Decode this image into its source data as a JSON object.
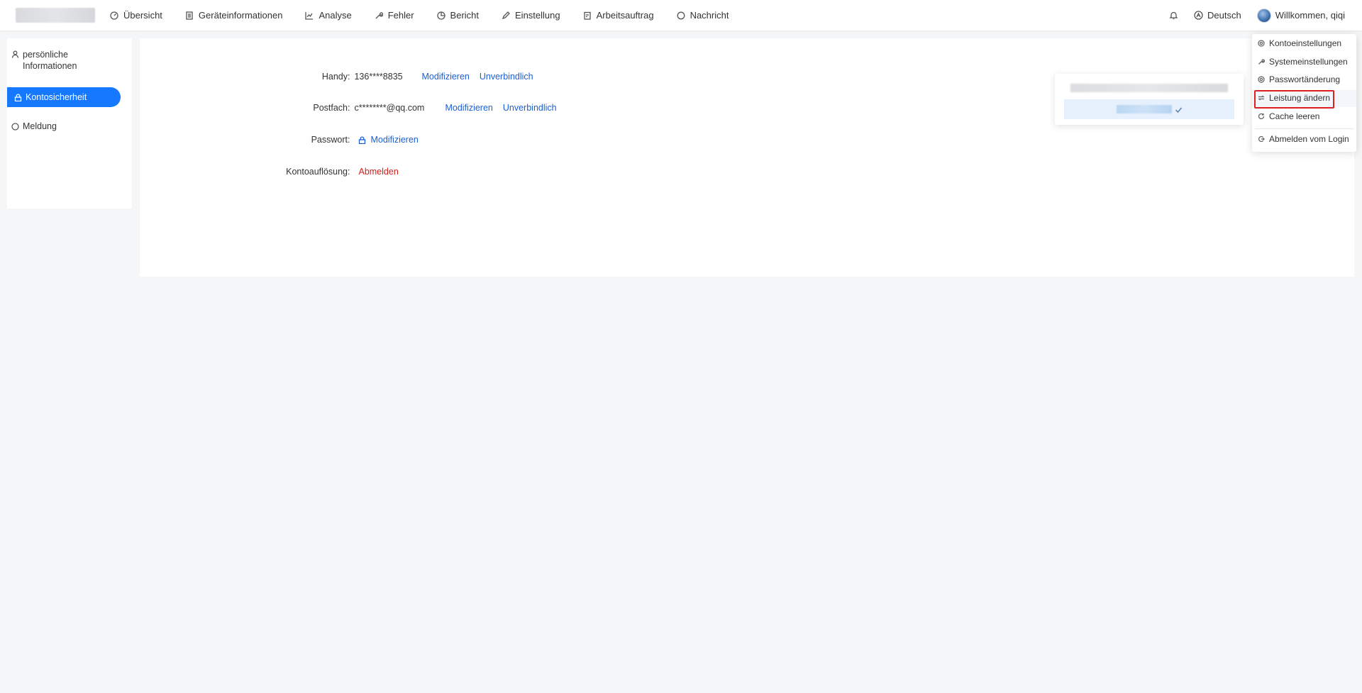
{
  "nav": {
    "items": [
      {
        "label": "Übersicht",
        "icon": "dashboard-icon"
      },
      {
        "label": "Geräteinformationen",
        "icon": "list-icon"
      },
      {
        "label": "Analyse",
        "icon": "chart-line-icon"
      },
      {
        "label": "Fehler",
        "icon": "wrench-icon"
      },
      {
        "label": "Bericht",
        "icon": "pie-chart-icon"
      },
      {
        "label": "Einstellung",
        "icon": "pencil-icon"
      },
      {
        "label": "Arbeitsauftrag",
        "icon": "clipboard-icon"
      },
      {
        "label": "Nachricht",
        "icon": "chat-icon"
      }
    ],
    "language": "Deutsch",
    "welcome": "Willkommen, qiqi"
  },
  "sidebar": {
    "items": [
      {
        "label": "persönliche Informationen",
        "icon": "user-icon"
      },
      {
        "label": "Kontosicherheit",
        "icon": "lock-icon",
        "active": true
      },
      {
        "label": "Meldung",
        "icon": "chat-icon"
      }
    ]
  },
  "security": {
    "phone": {
      "label": "Handy",
      "value": "136****8835",
      "modify": "Modifizieren",
      "unbind": "Unverbindlich"
    },
    "mail": {
      "label": "Postfach",
      "value": "c********@qq.com",
      "modify": "Modifizieren",
      "unbind": "Unverbindlich"
    },
    "password": {
      "label": "Passwort",
      "modify": "Modifizieren"
    },
    "cancellation": {
      "label": "Kontoauflösung",
      "action": "Abmelden"
    }
  },
  "dropdown": {
    "items": [
      {
        "label": "Kontoeinstellungen",
        "icon": "gear-icon"
      },
      {
        "label": "Systemeinstellungen",
        "icon": "wrench-icon"
      },
      {
        "label": "Passwortänderung",
        "icon": "gear-icon"
      },
      {
        "label": "Leistung ändern",
        "icon": "swap-icon",
        "highlighted": true
      },
      {
        "label": "Cache leeren",
        "icon": "refresh-icon"
      },
      {
        "label": "Abmelden vom Login",
        "icon": "logout-icon"
      }
    ]
  },
  "colors": {
    "accent": "#1677ff",
    "link": "#1b5fd6",
    "danger": "#d0211c",
    "highlight": "#e02020"
  }
}
